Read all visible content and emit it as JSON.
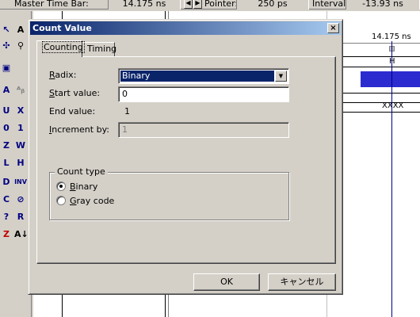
{
  "app": {
    "master_time_bar_label": "Master Time Bar:",
    "master_time_bar_value": "14.175 ns",
    "pointer_label": "Pointer:",
    "pointer_value": "250 ps",
    "interval_label": "Interval:",
    "interval_value": "-13.93 ns",
    "left_arrow": "◀",
    "right_arrow": "▶"
  },
  "waveform": {
    "cursor_time_label": "14.175 ns",
    "bus_row_value_1": "H",
    "bus_row_value_2": "XXXX"
  },
  "toolbar_icons": [
    "pointer-icon",
    "text-tool-icon",
    "node-finder-icon",
    "zoom-icon",
    "full-screen-icon",
    "find-icon",
    "replace-icon",
    "uninitialized-icon",
    "forcing-low-icon",
    "forcing-high-icon",
    "invert-icon",
    "count-value-icon",
    "clock-icon",
    "arbitrary-value-icon",
    "random-value-icon",
    "sort-icon"
  ],
  "dialog": {
    "title": "Count Value",
    "close_glyph": "×",
    "tabs": [
      {
        "label": "Counting",
        "active": true
      },
      {
        "label": "Timing",
        "active": false
      }
    ],
    "radix": {
      "label_accel": "R",
      "label_rest": "adix:",
      "value": "Binary",
      "dropdown_glyph": "▼"
    },
    "start_value": {
      "label_accel": "S",
      "label_rest": "tart value:",
      "value": "0"
    },
    "end_value": {
      "label": "End value:",
      "value": "1"
    },
    "increment_by": {
      "label_accel": "I",
      "label_rest": "ncrement by:",
      "value": "1",
      "enabled": false
    },
    "count_type": {
      "legend": "Count type",
      "options": [
        {
          "label_accel": "B",
          "label_rest": "inary",
          "selected": true
        },
        {
          "label_accel": "G",
          "label_rest": "ray code",
          "selected": false
        }
      ]
    },
    "ok_label": "OK",
    "cancel_label": "キャンセル"
  }
}
